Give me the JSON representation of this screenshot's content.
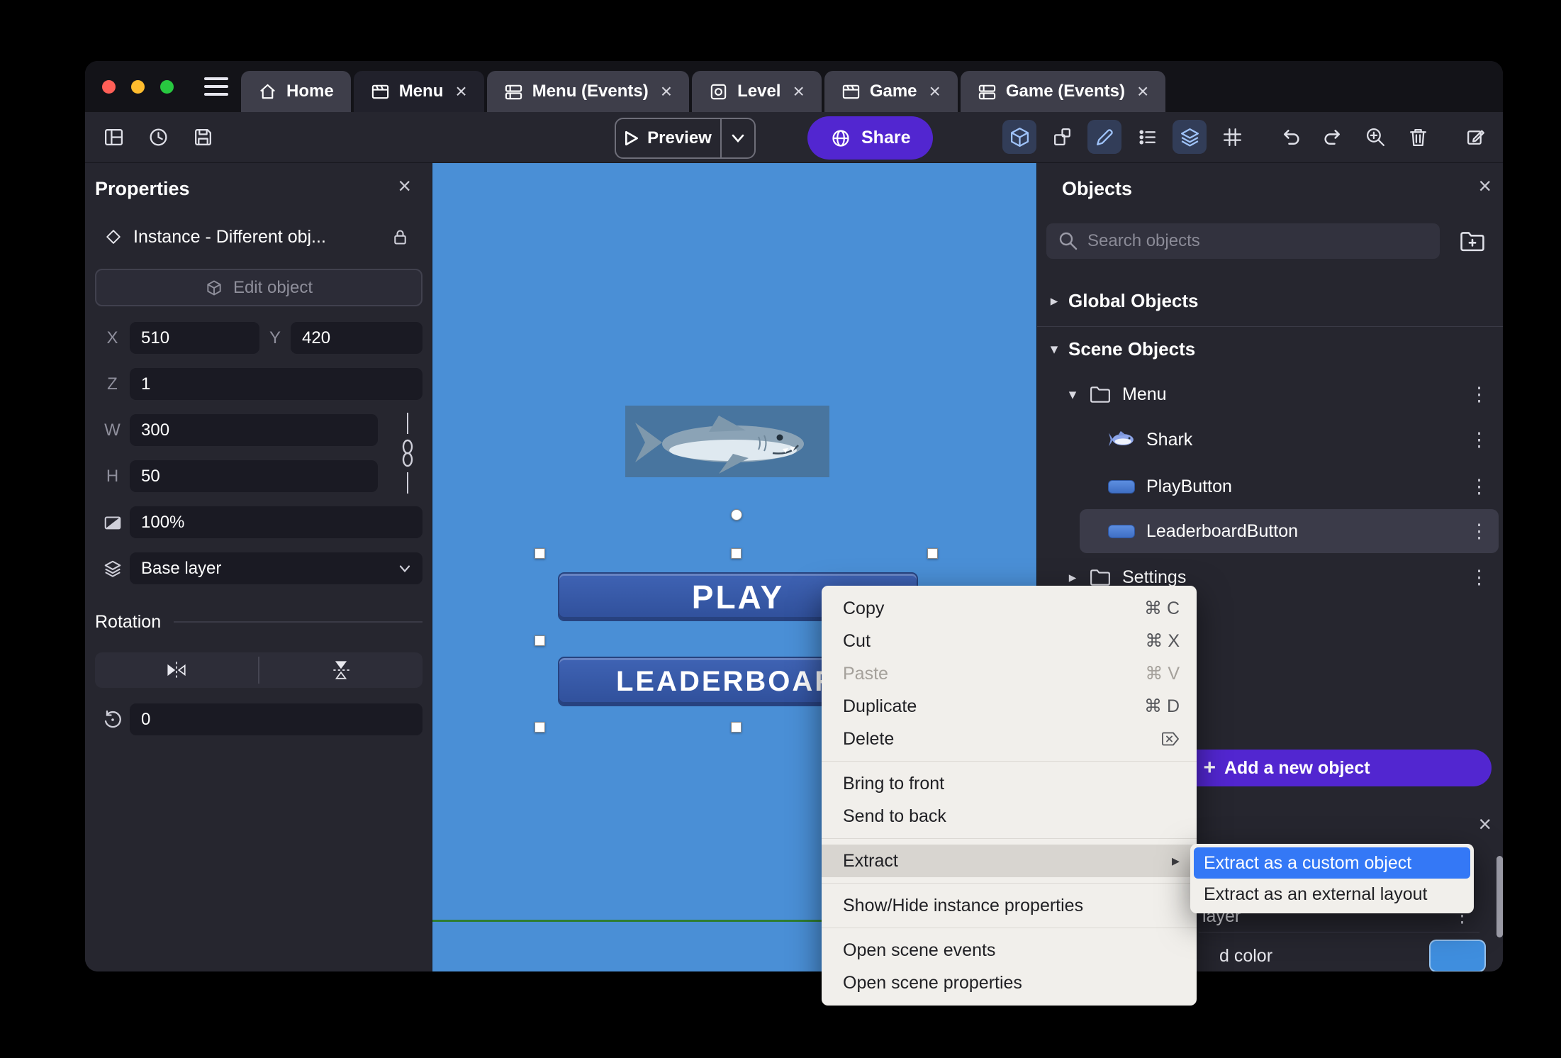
{
  "theme": {
    "accent_purple": "#5226d0",
    "canvas_blue": "#4a8fd6",
    "menu_select_blue": "#3478f6",
    "game_button_blue": "#30509b",
    "scene_border_green": "#2e7d32"
  },
  "icons": {
    "close": "×",
    "kebab": "⋮",
    "chevron_down": "▾",
    "chevron_right": "▸",
    "plus": "+",
    "menu_arrow": "▸"
  },
  "window": {
    "tabs": [
      {
        "label": "Home",
        "icon": "home-icon",
        "closable": false,
        "active": false
      },
      {
        "label": "Menu",
        "icon": "scene-icon",
        "closable": true,
        "active": true
      },
      {
        "label": "Menu (Events)",
        "icon": "events-sheet-icon",
        "closable": true,
        "active": false
      },
      {
        "label": "Level",
        "icon": "external-layout-icon",
        "closable": true,
        "active": false
      },
      {
        "label": "Game",
        "icon": "scene-icon",
        "closable": true,
        "active": false
      },
      {
        "label": "Game (Events)",
        "icon": "events-sheet-icon",
        "closable": true,
        "active": false
      }
    ]
  },
  "toolbar": {
    "preview_label": "Preview",
    "share_label": "Share"
  },
  "properties_panel": {
    "title": "Properties",
    "instance_label": "Instance  -  Different obj...",
    "edit_object_label": "Edit object",
    "fields": {
      "x_label": "X",
      "x_value": "510",
      "y_label": "Y",
      "y_value": "420",
      "z_label": "Z",
      "z_value": "1",
      "w_label": "W",
      "w_value": "300",
      "h_label": "H",
      "h_value": "50",
      "opacity_value": "100%",
      "layer_value": "Base layer",
      "rotation_section": "Rotation",
      "angle_value": "0"
    }
  },
  "canvas": {
    "play_label": "PLAY",
    "leaderboard_label": "LEADERBOARD"
  },
  "context_menu": {
    "items": [
      {
        "label": "Copy",
        "shortcut": "⌘ C"
      },
      {
        "label": "Cut",
        "shortcut": "⌘ X"
      },
      {
        "label": "Paste",
        "shortcut": "⌘ V",
        "disabled": true
      },
      {
        "label": "Duplicate",
        "shortcut": "⌘ D"
      },
      {
        "label": "Delete",
        "shortcut_icon": "delete-key-icon"
      },
      {
        "label": "Bring to front"
      },
      {
        "label": "Send to back"
      },
      {
        "label": "Extract",
        "highlighted": true,
        "has_submenu": true
      },
      {
        "label": "Show/Hide instance properties"
      },
      {
        "label": "Open scene events"
      },
      {
        "label": "Open scene properties"
      }
    ]
  },
  "extract_submenu": {
    "items": [
      {
        "label": "Extract as a custom object",
        "selected": true
      },
      {
        "label": "Extract as an external layout",
        "selected": false
      }
    ]
  },
  "objects_panel": {
    "title": "Objects",
    "search_placeholder": "Search objects",
    "global_section": "Global Objects",
    "scene_section": "Scene Objects",
    "tree": [
      {
        "label": "Menu",
        "type": "folder",
        "expanded": true
      },
      {
        "label": "Shark",
        "type": "object",
        "icon": "shark-icon"
      },
      {
        "label": "PlayButton",
        "type": "object",
        "icon": "button-sprite-icon"
      },
      {
        "label": "LeaderboardButton",
        "type": "object",
        "icon": "button-sprite-icon",
        "selected": true
      },
      {
        "label": "Settings",
        "type": "folder",
        "expanded": false
      }
    ],
    "add_button_label": "Add a new object"
  },
  "bottom_panel": {
    "layer_fragment": "layer",
    "color_fragment": "d color"
  }
}
